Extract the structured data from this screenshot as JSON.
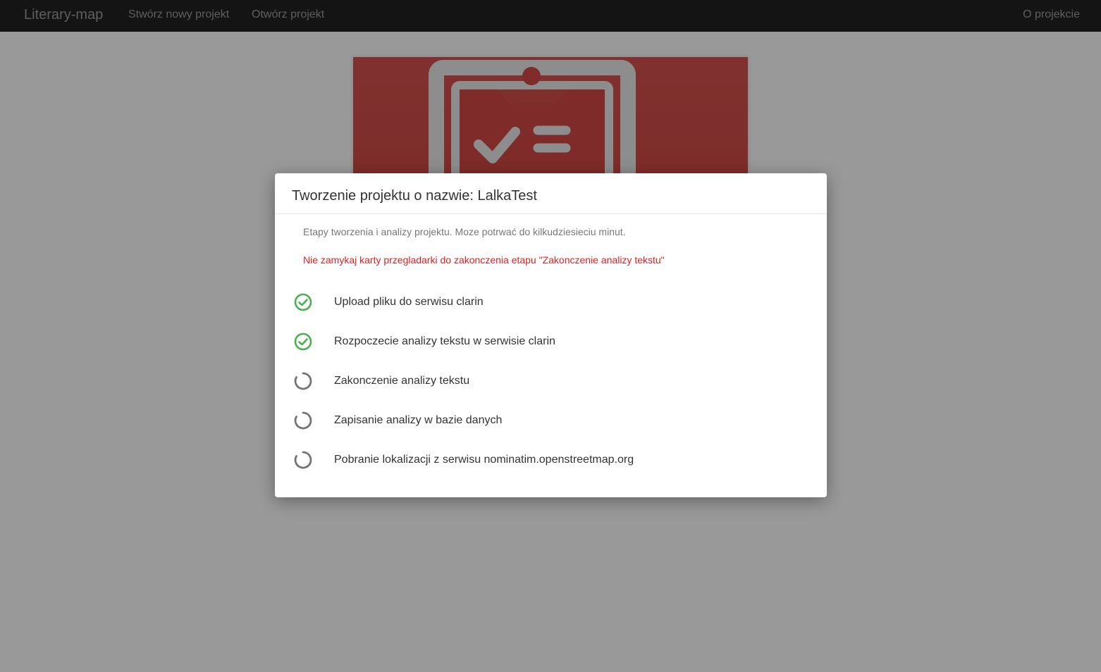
{
  "navbar": {
    "brand": "Literary-map",
    "create_project": "Stwórz nowy projekt",
    "open_project": "Otwórz projekt",
    "about": "O projekcie"
  },
  "modal": {
    "title": "Tworzenie projektu o nazwie: LalkaTest",
    "subtitle": "Etapy tworzenia i analizy projektu. Moze potrwać do kilkudziesieciu minut.",
    "warning": "Nie zamykaj karty przegladarki do zakonczenia etapu \"Zakonczenie analizy tekstu\"",
    "steps": [
      {
        "label": "Upload pliku do serwisu clarin",
        "status": "done",
        "icon": "check-circle-icon"
      },
      {
        "label": "Rozpoczecie analizy tekstu w serwisie clarin",
        "status": "done",
        "icon": "check-circle-icon"
      },
      {
        "label": "Zakonczenie analizy tekstu",
        "status": "pending",
        "icon": "spinner-icon"
      },
      {
        "label": "Zapisanie analizy w bazie danych",
        "status": "pending",
        "icon": "spinner-icon"
      },
      {
        "label": "Pobranie lokalizacji z serwisu nominatim.openstreetmap.org",
        "status": "pending",
        "icon": "spinner-icon"
      }
    ]
  },
  "colors": {
    "navbar_bg": "#222222",
    "hero_red": "#d0443f",
    "done_green": "#4caf50",
    "pending_gray": "#757575",
    "warning_red": "#e02020"
  }
}
